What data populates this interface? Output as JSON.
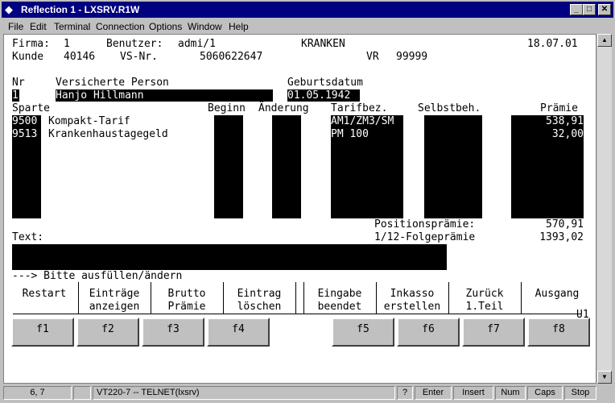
{
  "window": {
    "title": "Reflection 1 - LXSRV.R1W",
    "min_glyph": "_",
    "max_glyph": "□",
    "close_glyph": "✕"
  },
  "menu": [
    "File",
    "Edit",
    "Terminal",
    "Connection",
    "Options",
    "Window",
    "Help"
  ],
  "header": {
    "firma_label": "Firma:",
    "firma_value": "1",
    "benutzer_label": "Benutzer:",
    "benutzer_value": "admi/1",
    "module": "KRANKEN",
    "date": "18.07.01",
    "kunde_label": "Kunde",
    "kunde_value": "40146",
    "vsnr_label": "VS-Nr.",
    "vsnr_value": "5060622647",
    "vr_label": "VR",
    "vr_value": "99999"
  },
  "person": {
    "nr_label": "Nr",
    "name_label": "Versicherte Person",
    "birth_label": "Geburtsdatum",
    "nr_value": "1",
    "name_value": "Hanjo Hillmann",
    "birth_value": "01.05.1942"
  },
  "table": {
    "columns": {
      "sparte": "Sparte",
      "beginn": "Beginn",
      "aenderung": "Änderung",
      "tarif": "Tarifbez.",
      "selbst": "Selbstbeh.",
      "praemie": "Prämie"
    },
    "rows": [
      {
        "code": "9500",
        "name": "Kompakt-Tarif",
        "tarif": "AM1/ZM3/SM",
        "praemie": "538,91"
      },
      {
        "code": "9513",
        "name": "Krankenhaustagegeld",
        "tarif": "PM 100",
        "praemie": "32,00"
      }
    ]
  },
  "totals": {
    "position_label": "Positionsprämie:",
    "position_value": "570,91",
    "folge_label": "1/12-Folgeprämie",
    "folge_value": "1393,02"
  },
  "text_label": "Text:",
  "prompt": "---> Bitte ausfüllen/ändern",
  "screen_id": "U1",
  "fkey_labels": [
    {
      "line1": "Restart",
      "line2": ""
    },
    {
      "line1": "Einträge",
      "line2": "anzeigen"
    },
    {
      "line1": "Brutto",
      "line2": "Prämie"
    },
    {
      "line1": "Eintrag",
      "line2": "löschen"
    },
    {
      "line1": "Eingabe",
      "line2": "beendet"
    },
    {
      "line1": "Inkasso",
      "line2": "erstellen"
    },
    {
      "line1": "Zurück",
      "line2": "1.Teil"
    },
    {
      "line1": "Ausgang",
      "line2": ""
    }
  ],
  "fkeys": [
    "f1",
    "f2",
    "f3",
    "f4",
    "f5",
    "f6",
    "f7",
    "f8"
  ],
  "status": {
    "cursor": "6, 7",
    "connection": "VT220-7 -- TELNET(lxsrv)",
    "help": "?",
    "enter": "Enter",
    "insert": "Insert",
    "num": "Num",
    "caps": "Caps",
    "stop": "Stop"
  }
}
